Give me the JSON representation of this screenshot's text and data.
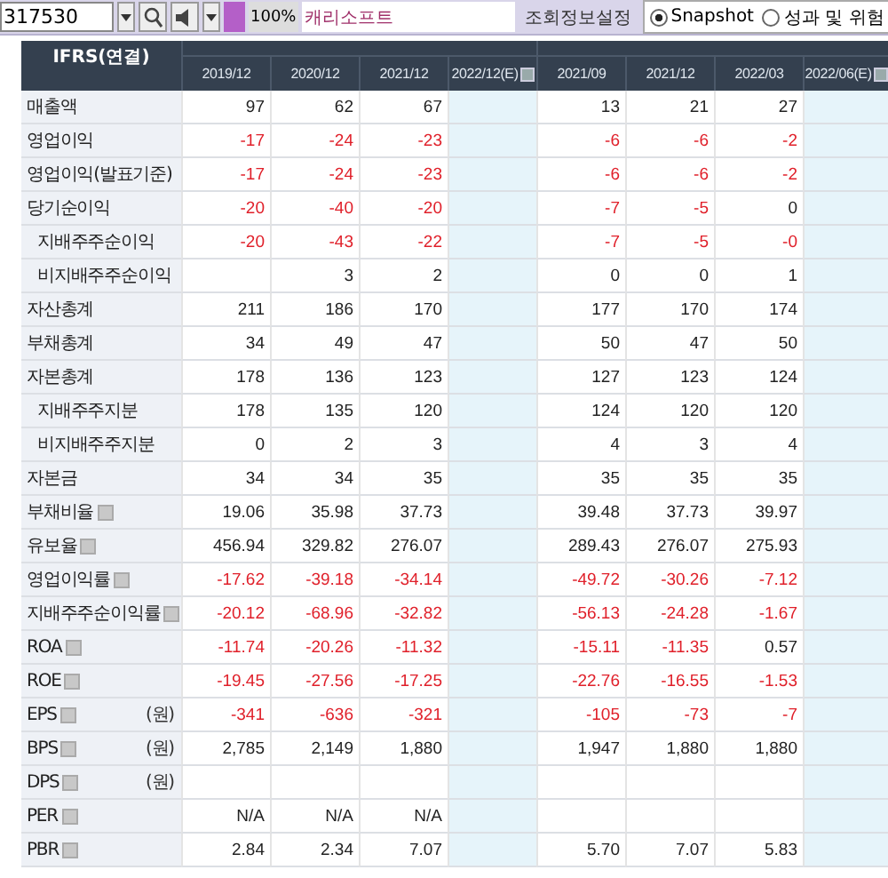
{
  "toolbar": {
    "code": "317530",
    "zoom": "100%",
    "company": "캐리소프트",
    "settings_button": "조회정보설정",
    "views": [
      {
        "label": "Snapshot",
        "selected": true
      },
      {
        "label": "성과 및 위험",
        "selected": false
      }
    ]
  },
  "table": {
    "title": "IFRS(연결)",
    "columns": [
      {
        "label": "2019/12",
        "estimate": false
      },
      {
        "label": "2020/12",
        "estimate": false
      },
      {
        "label": "2021/12",
        "estimate": false
      },
      {
        "label": "2022/12(E)",
        "estimate": true
      },
      {
        "label": "2021/09",
        "estimate": false
      },
      {
        "label": "2021/12",
        "estimate": false
      },
      {
        "label": "2022/03",
        "estimate": false
      },
      {
        "label": "2022/06(E)",
        "estimate": true
      }
    ],
    "rows": [
      {
        "label": "매출액",
        "help": false,
        "cells": [
          {
            "v": "97",
            "neg": false
          },
          {
            "v": "62",
            "neg": false
          },
          {
            "v": "67",
            "neg": false
          },
          null,
          {
            "v": "13",
            "neg": false
          },
          {
            "v": "21",
            "neg": false
          },
          {
            "v": "27",
            "neg": false
          },
          null
        ]
      },
      {
        "label": "영업이익",
        "help": false,
        "cells": [
          {
            "v": "-17",
            "neg": true
          },
          {
            "v": "-24",
            "neg": true
          },
          {
            "v": "-23",
            "neg": true
          },
          null,
          {
            "v": "-6",
            "neg": true
          },
          {
            "v": "-6",
            "neg": true
          },
          {
            "v": "-2",
            "neg": true
          },
          null
        ]
      },
      {
        "label": "영업이익(발표기준)",
        "help": false,
        "cells": [
          {
            "v": "-17",
            "neg": true
          },
          {
            "v": "-24",
            "neg": true
          },
          {
            "v": "-23",
            "neg": true
          },
          null,
          {
            "v": "-6",
            "neg": true
          },
          {
            "v": "-6",
            "neg": true
          },
          {
            "v": "-2",
            "neg": true
          },
          null
        ]
      },
      {
        "label": "당기순이익",
        "help": false,
        "cells": [
          {
            "v": "-20",
            "neg": true
          },
          {
            "v": "-40",
            "neg": true
          },
          {
            "v": "-20",
            "neg": true
          },
          null,
          {
            "v": "-7",
            "neg": true
          },
          {
            "v": "-5",
            "neg": true
          },
          {
            "v": "0",
            "neg": false
          },
          null
        ],
        "children": [
          {
            "label": "지배주주순이익",
            "help": false,
            "cells": [
              {
                "v": "-20",
                "neg": true
              },
              {
                "v": "-43",
                "neg": true
              },
              {
                "v": "-22",
                "neg": true
              },
              null,
              {
                "v": "-7",
                "neg": true
              },
              {
                "v": "-5",
                "neg": true
              },
              {
                "v": "-0",
                "neg": true
              },
              null
            ]
          },
          {
            "label": "비지배주주순이익",
            "help": false,
            "cells": [
              null,
              {
                "v": "3",
                "neg": false
              },
              {
                "v": "2",
                "neg": false
              },
              null,
              {
                "v": "0",
                "neg": false
              },
              {
                "v": "0",
                "neg": false
              },
              {
                "v": "1",
                "neg": false
              },
              null
            ]
          }
        ]
      },
      {
        "label": "자산총계",
        "help": false,
        "cells": [
          {
            "v": "211",
            "neg": false
          },
          {
            "v": "186",
            "neg": false
          },
          {
            "v": "170",
            "neg": false
          },
          null,
          {
            "v": "177",
            "neg": false
          },
          {
            "v": "170",
            "neg": false
          },
          {
            "v": "174",
            "neg": false
          },
          null
        ]
      },
      {
        "label": "부채총계",
        "help": false,
        "cells": [
          {
            "v": "34",
            "neg": false
          },
          {
            "v": "49",
            "neg": false
          },
          {
            "v": "47",
            "neg": false
          },
          null,
          {
            "v": "50",
            "neg": false
          },
          {
            "v": "47",
            "neg": false
          },
          {
            "v": "50",
            "neg": false
          },
          null
        ]
      },
      {
        "label": "자본총계",
        "help": false,
        "cells": [
          {
            "v": "178",
            "neg": false
          },
          {
            "v": "136",
            "neg": false
          },
          {
            "v": "123",
            "neg": false
          },
          null,
          {
            "v": "127",
            "neg": false
          },
          {
            "v": "123",
            "neg": false
          },
          {
            "v": "124",
            "neg": false
          },
          null
        ],
        "children": [
          {
            "label": "지배주주지분",
            "help": false,
            "cells": [
              {
                "v": "178",
                "neg": false
              },
              {
                "v": "135",
                "neg": false
              },
              {
                "v": "120",
                "neg": false
              },
              null,
              {
                "v": "124",
                "neg": false
              },
              {
                "v": "120",
                "neg": false
              },
              {
                "v": "120",
                "neg": false
              },
              null
            ]
          },
          {
            "label": "비지배주주지분",
            "help": false,
            "cells": [
              {
                "v": "0",
                "neg": false
              },
              {
                "v": "2",
                "neg": false
              },
              {
                "v": "3",
                "neg": false
              },
              null,
              {
                "v": "4",
                "neg": false
              },
              {
                "v": "3",
                "neg": false
              },
              {
                "v": "4",
                "neg": false
              },
              null
            ]
          }
        ]
      },
      {
        "label": "자본금",
        "help": false,
        "cells": [
          {
            "v": "34",
            "neg": false
          },
          {
            "v": "34",
            "neg": false
          },
          {
            "v": "35",
            "neg": false
          },
          null,
          {
            "v": "35",
            "neg": false
          },
          {
            "v": "35",
            "neg": false
          },
          {
            "v": "35",
            "neg": false
          },
          null
        ]
      },
      {
        "label": "부채비율",
        "help": true,
        "cells": [
          {
            "v": "19.06",
            "neg": false
          },
          {
            "v": "35.98",
            "neg": false
          },
          {
            "v": "37.73",
            "neg": false
          },
          null,
          {
            "v": "39.48",
            "neg": false
          },
          {
            "v": "37.73",
            "neg": false
          },
          {
            "v": "39.97",
            "neg": false
          },
          null
        ]
      },
      {
        "label": "유보율",
        "help": true,
        "cells": [
          {
            "v": "456.94",
            "neg": false
          },
          {
            "v": "329.82",
            "neg": false
          },
          {
            "v": "276.07",
            "neg": false
          },
          null,
          {
            "v": "289.43",
            "neg": false
          },
          {
            "v": "276.07",
            "neg": false
          },
          {
            "v": "275.93",
            "neg": false
          },
          null
        ]
      },
      {
        "label": "영업이익률",
        "help": true,
        "cells": [
          {
            "v": "-17.62",
            "neg": true
          },
          {
            "v": "-39.18",
            "neg": true
          },
          {
            "v": "-34.14",
            "neg": true
          },
          null,
          {
            "v": "-49.72",
            "neg": true
          },
          {
            "v": "-30.26",
            "neg": true
          },
          {
            "v": "-7.12",
            "neg": true
          },
          null
        ]
      },
      {
        "label": "지배주주순이익률",
        "help": true,
        "cells": [
          {
            "v": "-20.12",
            "neg": true
          },
          {
            "v": "-68.96",
            "neg": true
          },
          {
            "v": "-32.82",
            "neg": true
          },
          null,
          {
            "v": "-56.13",
            "neg": true
          },
          {
            "v": "-24.28",
            "neg": true
          },
          {
            "v": "-1.67",
            "neg": true
          },
          null
        ]
      },
      {
        "label": "ROA",
        "help": true,
        "cells": [
          {
            "v": "-11.74",
            "neg": true
          },
          {
            "v": "-20.26",
            "neg": true
          },
          {
            "v": "-11.32",
            "neg": true
          },
          null,
          {
            "v": "-15.11",
            "neg": true
          },
          {
            "v": "-11.35",
            "neg": true
          },
          {
            "v": "0.57",
            "neg": false
          },
          null
        ]
      },
      {
        "label": "ROE",
        "help": true,
        "cells": [
          {
            "v": "-19.45",
            "neg": true
          },
          {
            "v": "-27.56",
            "neg": true
          },
          {
            "v": "-17.25",
            "neg": true
          },
          null,
          {
            "v": "-22.76",
            "neg": true
          },
          {
            "v": "-16.55",
            "neg": true
          },
          {
            "v": "-1.53",
            "neg": true
          },
          null
        ]
      },
      {
        "label": "EPS",
        "help": true,
        "unit": "(원)",
        "cells": [
          {
            "v": "-341",
            "neg": true
          },
          {
            "v": "-636",
            "neg": true
          },
          {
            "v": "-321",
            "neg": true
          },
          null,
          {
            "v": "-105",
            "neg": true
          },
          {
            "v": "-73",
            "neg": true
          },
          {
            "v": "-7",
            "neg": true
          },
          null
        ]
      },
      {
        "label": "BPS",
        "help": true,
        "unit": "(원)",
        "cells": [
          {
            "v": "2,785",
            "neg": false
          },
          {
            "v": "2,149",
            "neg": false
          },
          {
            "v": "1,880",
            "neg": false
          },
          null,
          {
            "v": "1,947",
            "neg": false
          },
          {
            "v": "1,880",
            "neg": false
          },
          {
            "v": "1,880",
            "neg": false
          },
          null
        ]
      },
      {
        "label": "DPS",
        "help": true,
        "unit": "(원)",
        "cells": [
          null,
          null,
          null,
          null,
          null,
          null,
          null,
          null
        ]
      },
      {
        "label": "PER",
        "help": true,
        "cells": [
          {
            "v": "N/A",
            "neg": false
          },
          {
            "v": "N/A",
            "neg": false
          },
          {
            "v": "N/A",
            "neg": false
          },
          null,
          null,
          null,
          null,
          null
        ]
      },
      {
        "label": "PBR",
        "help": true,
        "cells": [
          {
            "v": "2.84",
            "neg": false
          },
          {
            "v": "2.34",
            "neg": false
          },
          {
            "v": "7.07",
            "neg": false
          },
          null,
          {
            "v": "5.70",
            "neg": false
          },
          {
            "v": "7.07",
            "neg": false
          },
          {
            "v": "5.83",
            "neg": false
          },
          null
        ]
      }
    ]
  }
}
